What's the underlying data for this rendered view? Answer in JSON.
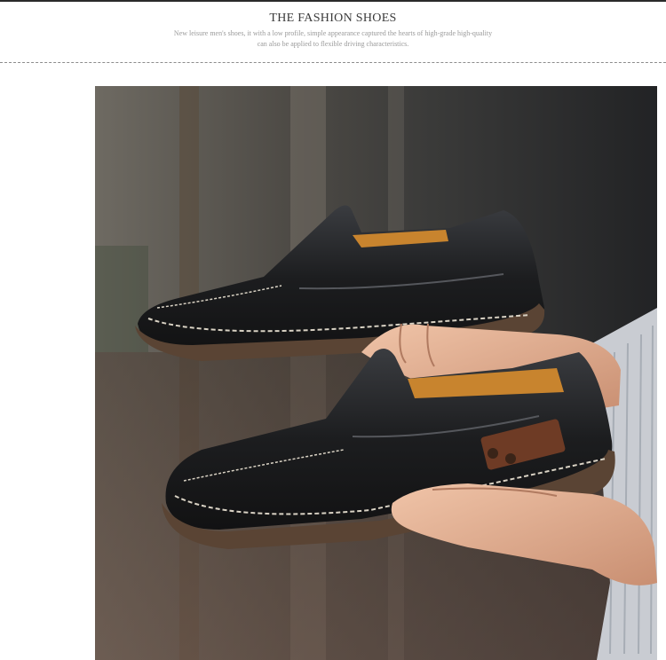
{
  "header": {
    "title": "THE FASHION SHOES",
    "subtitle_line1": "New leisure men's shoes, it with a low profile, simple appearance captured the hearts of high-grade high-quality",
    "subtitle_line2": "can also be applied to flexible driving characteristics."
  },
  "photo": {
    "subject": "two black leather slip-on loafers held in hands",
    "colors": {
      "leather": "#1c1d1f",
      "lining": "#c8842e",
      "sole": "#5a4434",
      "stitch": "#d9d2c4",
      "skin": "#e9b79a"
    }
  }
}
